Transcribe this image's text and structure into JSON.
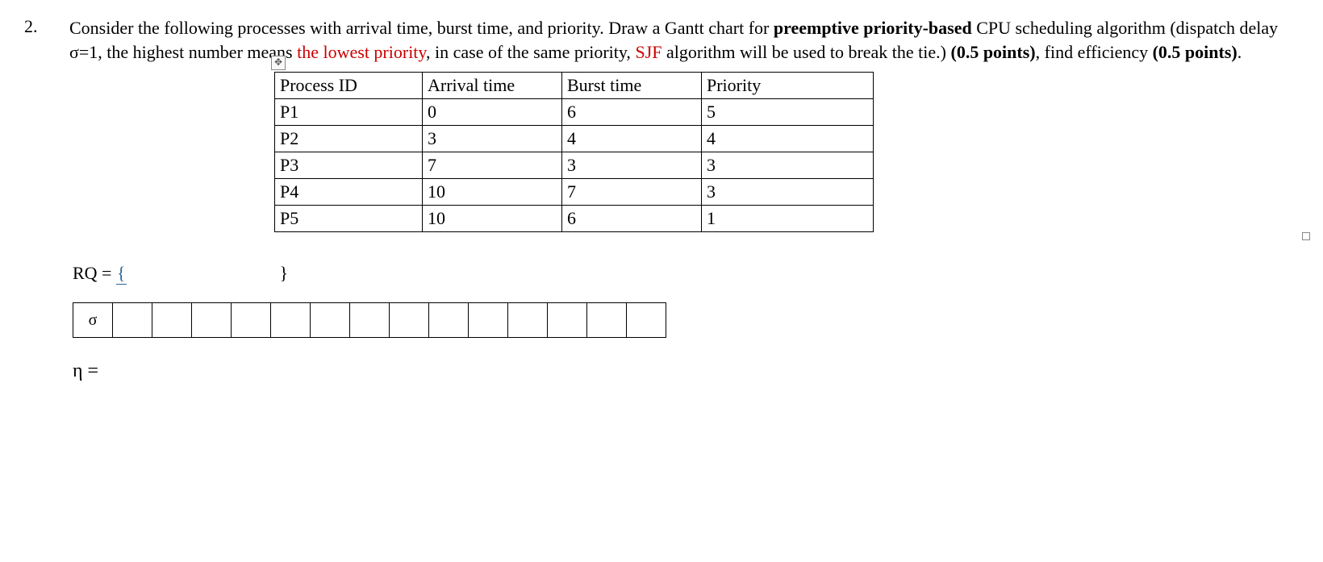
{
  "question": {
    "number": "2.",
    "text_parts": {
      "p1": "Consider the following processes with arrival time, burst time, and priority. Draw a Gantt chart for ",
      "p2_bold": "preemptive priority-based",
      "p3": " CPU scheduling algorithm (dispatch delay σ=1, the highest number means ",
      "p4_red": "the lowest priority",
      "p5": ", in case of the same priority, ",
      "p6_red": "SJF",
      "p7": " algorithm will be used to break the tie.) ",
      "p8_bold": "(0.5 points)",
      "p9": ", find efficiency ",
      "p10_bold": "(0.5 points)",
      "p11": "."
    }
  },
  "table": {
    "headers": {
      "pid": "Process ID",
      "arrival": "Arrival time",
      "burst": "Burst time",
      "priority": "Priority"
    },
    "rows": [
      {
        "pid": "P1",
        "arrival": "0",
        "burst": "6",
        "priority": "5"
      },
      {
        "pid": "P2",
        "arrival": "3",
        "burst": "4",
        "priority": "4"
      },
      {
        "pid": "P3",
        "arrival": "7",
        "burst": "3",
        "priority": "3"
      },
      {
        "pid": "P4",
        "arrival": "10",
        "burst": "7",
        "priority": "3"
      },
      {
        "pid": "P5",
        "arrival": "10",
        "burst": "6",
        "priority": "1"
      }
    ]
  },
  "rq": {
    "label": "RQ = ",
    "open": "{",
    "close": "}"
  },
  "gantt": {
    "first_cell": "σ",
    "blank_cells": 14
  },
  "eta_label": "η ="
}
